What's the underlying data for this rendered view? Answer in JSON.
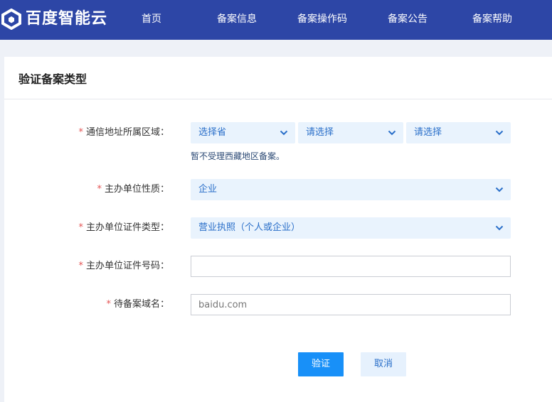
{
  "brand": {
    "name": "百度智能云"
  },
  "nav": {
    "items": [
      {
        "label": "首页"
      },
      {
        "label": "备案信息"
      },
      {
        "label": "备案操作码"
      },
      {
        "label": "备案公告"
      },
      {
        "label": "备案帮助"
      }
    ]
  },
  "page": {
    "title": "验证备案类型"
  },
  "form": {
    "required_mark": "*",
    "region": {
      "label": "通信地址所属区域：",
      "province": "选择省",
      "city": "请选择",
      "district": "请选择",
      "hint": "暂不受理西藏地区备案。"
    },
    "org_nature": {
      "label": "主办单位性质：",
      "value": "企业"
    },
    "cert_type": {
      "label": "主办单位证件类型：",
      "value": "营业执照（个人或企业）"
    },
    "cert_number": {
      "label": "主办单位证件号码：",
      "value": "",
      "placeholder": ""
    },
    "domain": {
      "label": "待备案域名：",
      "value": "",
      "placeholder": "baidu.com"
    }
  },
  "actions": {
    "verify": "验证",
    "cancel": "取消"
  },
  "colors": {
    "header_bg": "#2d46a6",
    "primary": "#1890f8",
    "select_bg": "#e9f3fd",
    "required": "#e45454"
  }
}
